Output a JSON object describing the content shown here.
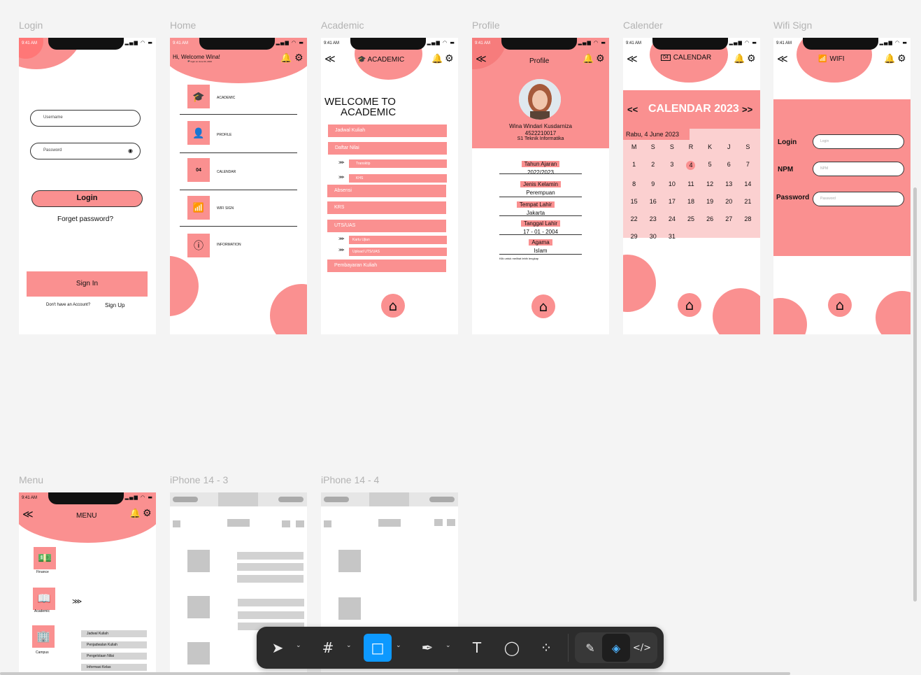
{
  "frames": {
    "login": {
      "label": "Login",
      "time": "9:41 AM",
      "status_icons": "▂▄▆ ◠ ▬",
      "username_ph": "Username",
      "password_ph": "Password",
      "eye_glyph": "◉",
      "login_btn": "Login",
      "forget": "Forget password?",
      "signin_btn": "Sign In",
      "no_account": "Don't have an Account?",
      "signup": "Sign Up"
    },
    "home": {
      "label": "Home",
      "time": "9:41 AM",
      "greeting": "Hi, Welcome Wina!",
      "login_note": "🏴 login on June 03, 2023",
      "bell_glyph": "🔔",
      "gear_glyph": "⚙",
      "items": [
        {
          "label": "ACADEMIC",
          "icon": "🎓"
        },
        {
          "label": "PROFILE",
          "icon": "👤"
        },
        {
          "label": "CALENDAR",
          "icon": "04"
        },
        {
          "label": "WIFI SIGN",
          "icon": "📶"
        },
        {
          "label": "INFORMATION",
          "icon": "ⓘ"
        }
      ]
    },
    "academic": {
      "label": "Academic",
      "time": "9:41 AM",
      "title": "ACADEMIC",
      "back_glyph": "≪",
      "welcome1": "WELCOME TO",
      "welcome2": "ACADEMIC",
      "items": [
        "Jadwal Kuliah",
        "Daftar Nilai",
        "Transktip",
        "KHS",
        "Absensi",
        "KRS",
        "UTS/UAS",
        "Kartu Ujian",
        "Upload UTS/UAS",
        "Pembayaran Kuliah"
      ],
      "sub_glyph": "⋙",
      "home_glyph": "⌂"
    },
    "profile": {
      "label": "Profile",
      "time": "9:41 AM",
      "title": "Profile",
      "name": "Wina Windari Kusdarniza",
      "nim": "4522210017",
      "prodi": "S1 Teknik Informatika",
      "fields": [
        {
          "k": "Tahun Ajaran",
          "v": "2022/2023"
        },
        {
          "k": "Jenis Kelamin",
          "v": "Perempuan"
        },
        {
          "k": "Tempat Lahir",
          "v": "Jakarta"
        },
        {
          "k": "Tanggal Lahir",
          "v": "17 - 01 - 2004"
        },
        {
          "k": "Agama",
          "v": "Islam"
        }
      ],
      "more": "Klik untuk melihat lebih lengkap"
    },
    "calendar": {
      "label": "Calender",
      "time": "9:41 AM",
      "title": "CALENDAR",
      "date_icon": "04",
      "prev": "<<",
      "next": ">>",
      "heading": "CALENDAR 2023",
      "today": "Rabu, 4 June 2023",
      "days": [
        "M",
        "S",
        "S",
        "R",
        "K",
        "J",
        "S"
      ],
      "weeks": [
        [
          "1",
          "2",
          "3",
          "4",
          "5",
          "6",
          "7"
        ],
        [
          "8",
          "9",
          "10",
          "11",
          "12",
          "13",
          "14"
        ],
        [
          "15",
          "16",
          "17",
          "18",
          "19",
          "20",
          "21"
        ],
        [
          "22",
          "23",
          "24",
          "25",
          "26",
          "27",
          "28"
        ],
        [
          "29",
          "30",
          "31",
          "",
          "",
          "",
          ""
        ]
      ]
    },
    "wifi": {
      "label": "Wifi Sign",
      "time": "9:41 AM",
      "title": "WIFI",
      "login_label": "Login",
      "login_ph": "Login",
      "npm_label": "NPM",
      "npm_ph": "NPM",
      "pwd_label": "Password",
      "pwd_ph": "Password"
    },
    "menu": {
      "label": "Menu",
      "time": "9:41 AM",
      "title": "MENU",
      "items": [
        {
          "label": "Finance",
          "icon": "💵"
        },
        {
          "label": "Academic",
          "icon": "📖"
        },
        {
          "label": "Campus",
          "icon": "🏢"
        }
      ],
      "arrow": "⋙",
      "sub": [
        "Jadwal Kuliah",
        "Penjadwalan Kuliah",
        "Pengelolaan Nilai",
        "Informasi Kelas"
      ]
    },
    "wire3": {
      "label": "iPhone 14 - 3"
    },
    "wire4": {
      "label": "iPhone 14 - 4"
    }
  },
  "toolbar": {
    "tools": [
      {
        "name": "move",
        "glyph": "➤"
      },
      {
        "name": "frame",
        "glyph": "#"
      },
      {
        "name": "rectangle",
        "glyph": "□"
      },
      {
        "name": "pen",
        "glyph": "✒"
      },
      {
        "name": "text",
        "glyph": "T"
      },
      {
        "name": "comment",
        "glyph": "◯"
      },
      {
        "name": "actions",
        "glyph": "⁘"
      },
      {
        "name": "draw",
        "glyph": "✎"
      },
      {
        "name": "design",
        "glyph": "◈"
      },
      {
        "name": "dev",
        "glyph": "</>"
      }
    ],
    "caret": "⌄"
  },
  "colors": {
    "accent": "#fa9090",
    "accent_light": "#fbd0d0",
    "toolbar": "#2c2c2c",
    "selected": "#0d99ff"
  }
}
